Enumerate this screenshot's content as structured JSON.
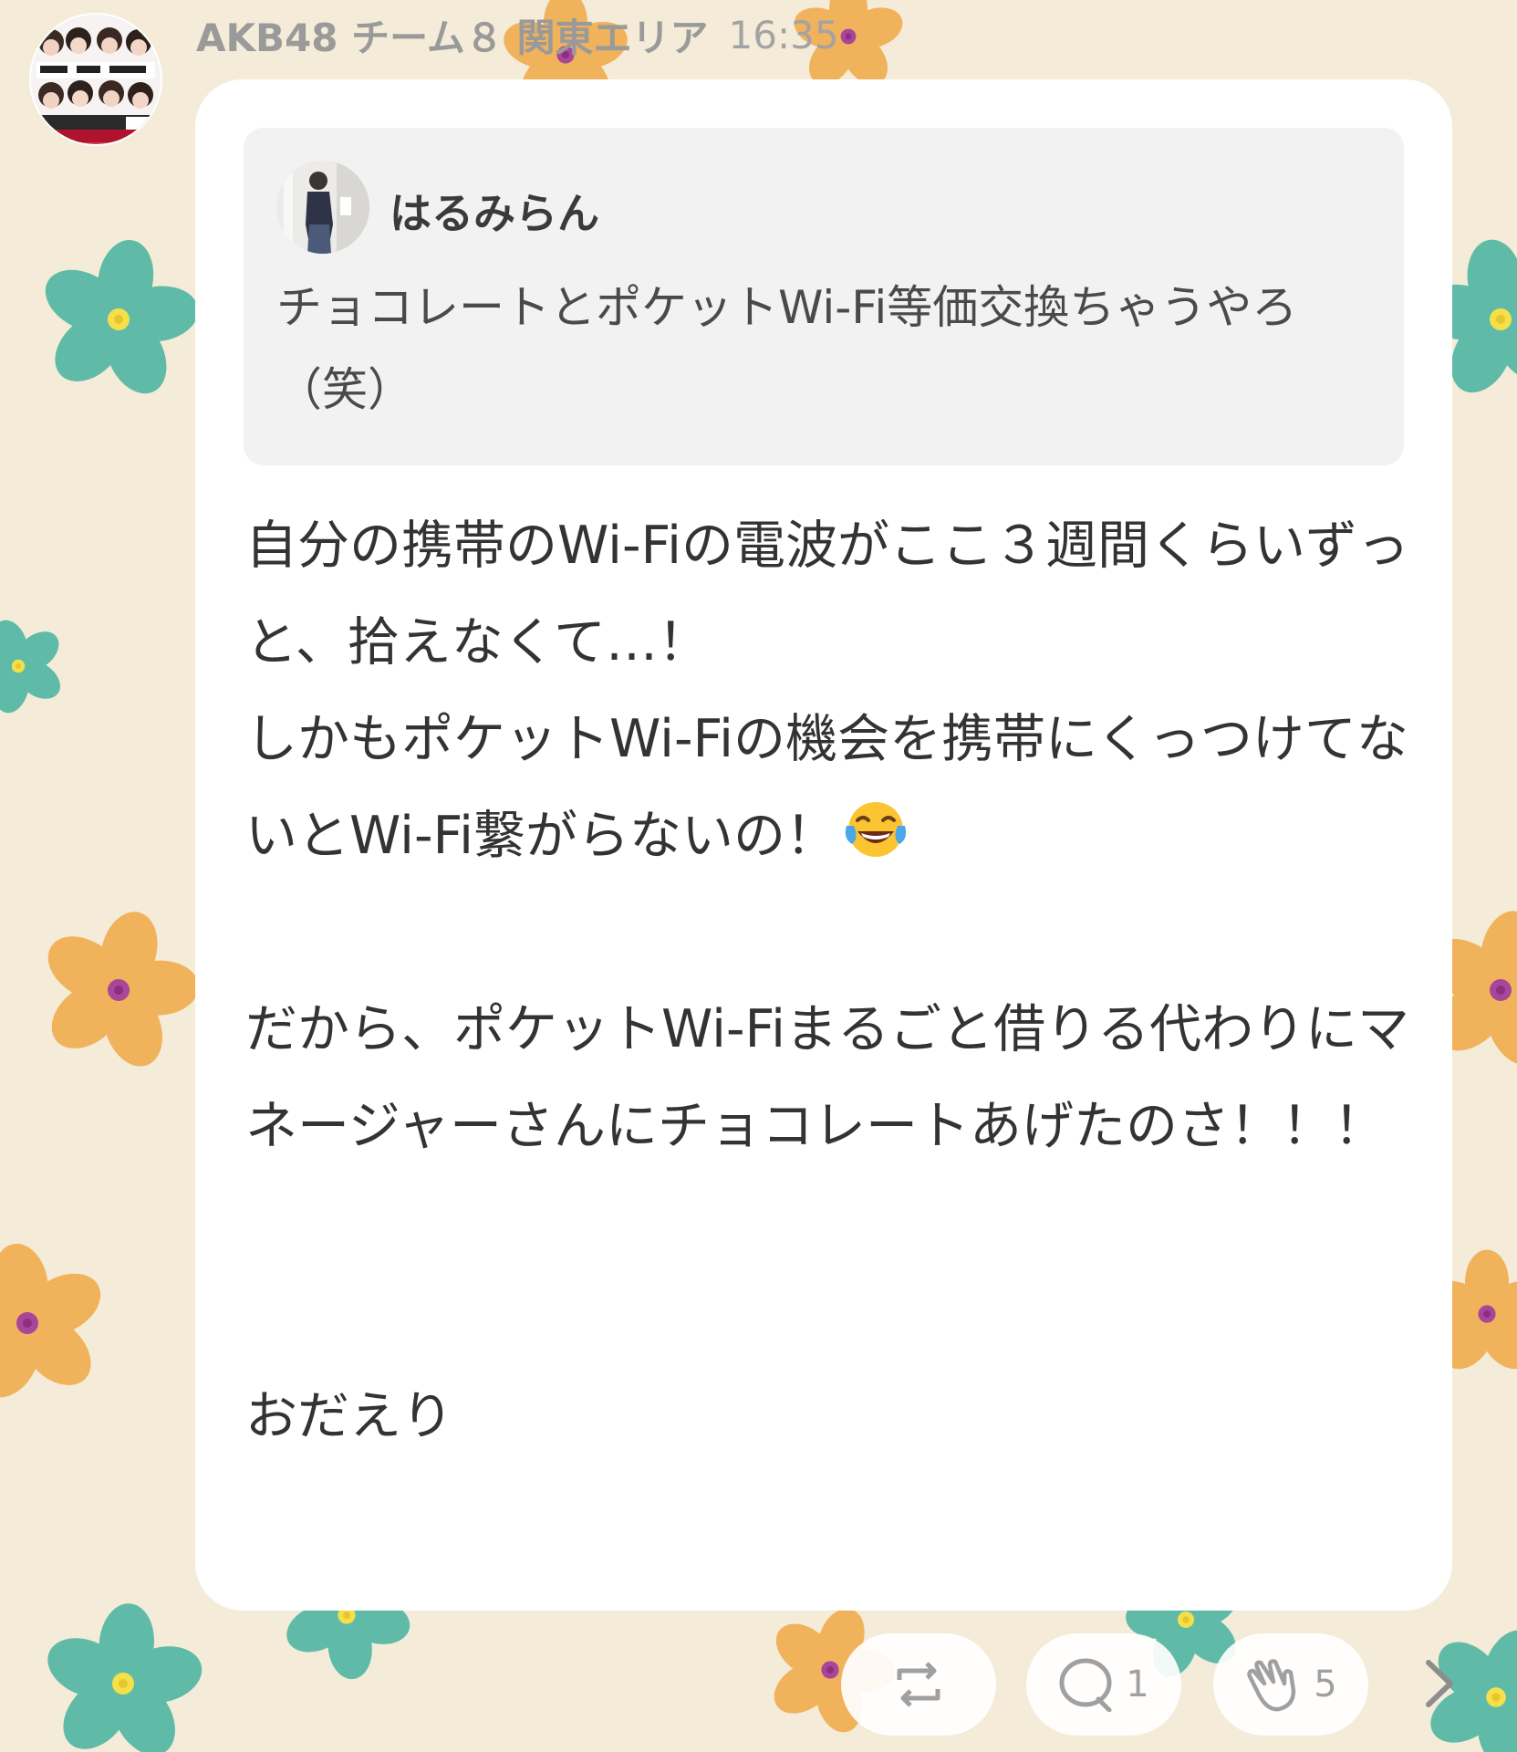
{
  "post": {
    "group_name": "AKB48 チーム８ 関東エリア",
    "time": "16:35",
    "quote": {
      "author": "はるみらん",
      "text": "チョコレートとポケットWi-Fi等価交換ちゃうやろ（笑）"
    },
    "body": {
      "paragraph1": "自分の携帯のWi-Fiの電波がここ３週間くらいずっと、拾えなくて…！",
      "paragraph2": "しかもポケットWi-Fiの機会を携帯にくっつけてないとWi-Fi繋がらないの！",
      "paragraph3": "だから、ポケットWi-Fiまるごと借りる代わりにマネージャーさんにチョコレートあげたのさ！！！",
      "signature": "おだえり"
    },
    "emoji_name": "face-with-tears-of-joy-icon"
  },
  "actions": {
    "repost_icon": "repost-icon",
    "comment_icon": "comment-icon",
    "comment_count": "1",
    "clap_icon": "clap-icon",
    "clap_count": "5",
    "next_icon": "chevron-right-icon"
  },
  "colors": {
    "background": "#f4ecd8",
    "flower_teal": "#5fbba7",
    "flower_orange": "#f0b25a",
    "card": "#ffffff",
    "quote_bg": "#f2f2f2"
  }
}
